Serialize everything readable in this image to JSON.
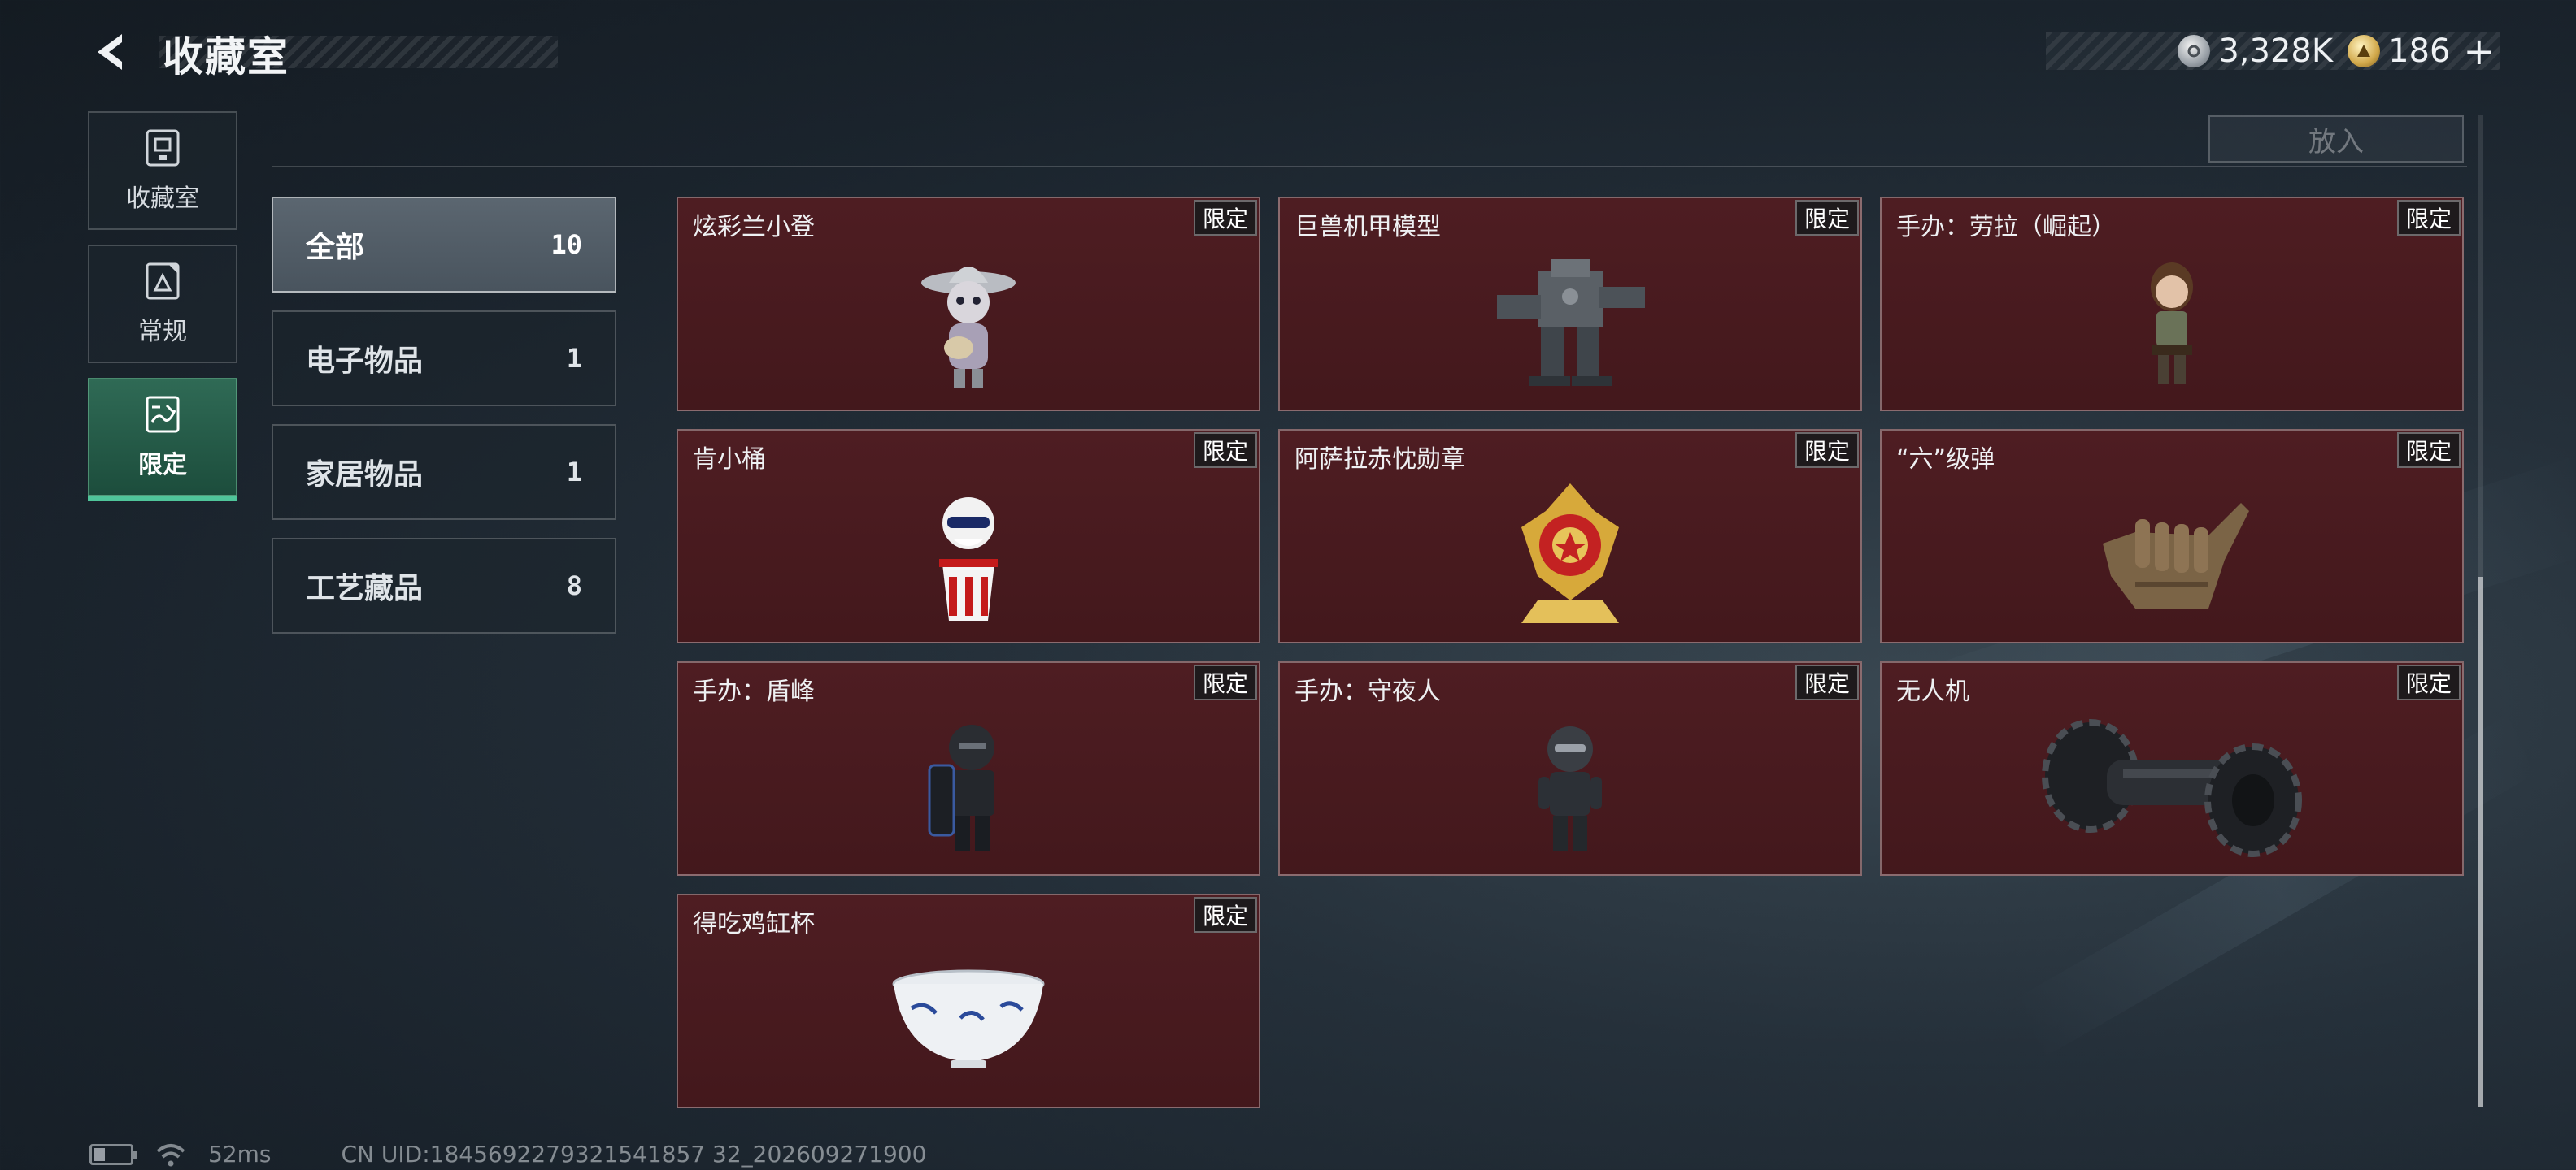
{
  "header": {
    "title": "收藏室",
    "currencies": [
      {
        "icon": "silver-coin-icon",
        "value": "3,328K"
      },
      {
        "icon": "gold-coin-icon",
        "value": "186"
      }
    ],
    "plus_label": "+"
  },
  "nav": {
    "items": [
      {
        "label": "收藏室",
        "icon": "collection-icon",
        "active": false
      },
      {
        "label": "常规",
        "icon": "regular-icon",
        "active": false
      },
      {
        "label": "限定",
        "icon": "limited-icon",
        "active": true
      }
    ]
  },
  "top_strip": {
    "put_label": "放入"
  },
  "categories": [
    {
      "label": "全部",
      "count": "10",
      "active": true
    },
    {
      "label": "电子物品",
      "count": "1",
      "active": false
    },
    {
      "label": "家居物品",
      "count": "1",
      "active": false
    },
    {
      "label": "工艺藏品",
      "count": "8",
      "active": false
    }
  ],
  "items": [
    {
      "name": "炫彩兰小登",
      "tag": "限定",
      "icon": "toy-figure-sombrero-icon"
    },
    {
      "name": "巨兽机甲模型",
      "tag": "限定",
      "icon": "mech-model-icon"
    },
    {
      "name": "手办：劳拉（崛起）",
      "tag": "限定",
      "icon": "figure-lara-icon"
    },
    {
      "name": "肯小桶",
      "tag": "限定",
      "icon": "bucket-figure-icon"
    },
    {
      "name": "阿萨拉赤忱勋章",
      "tag": "限定",
      "icon": "medal-icon"
    },
    {
      "name": "“六”级弹",
      "tag": "限定",
      "icon": "bullet-hand-icon"
    },
    {
      "name": "手办：盾峰",
      "tag": "限定",
      "icon": "figure-shield-icon"
    },
    {
      "name": "手办：守夜人",
      "tag": "限定",
      "icon": "figure-nightwatch-icon"
    },
    {
      "name": "无人机",
      "tag": "限定",
      "icon": "drone-icon"
    },
    {
      "name": "得吃鸡缸杯",
      "tag": "限定",
      "icon": "porcelain-cup-icon"
    }
  ],
  "footer": {
    "ping": "52ms",
    "uid": "CN UID:1845692279321541857 32_202609271900"
  }
}
